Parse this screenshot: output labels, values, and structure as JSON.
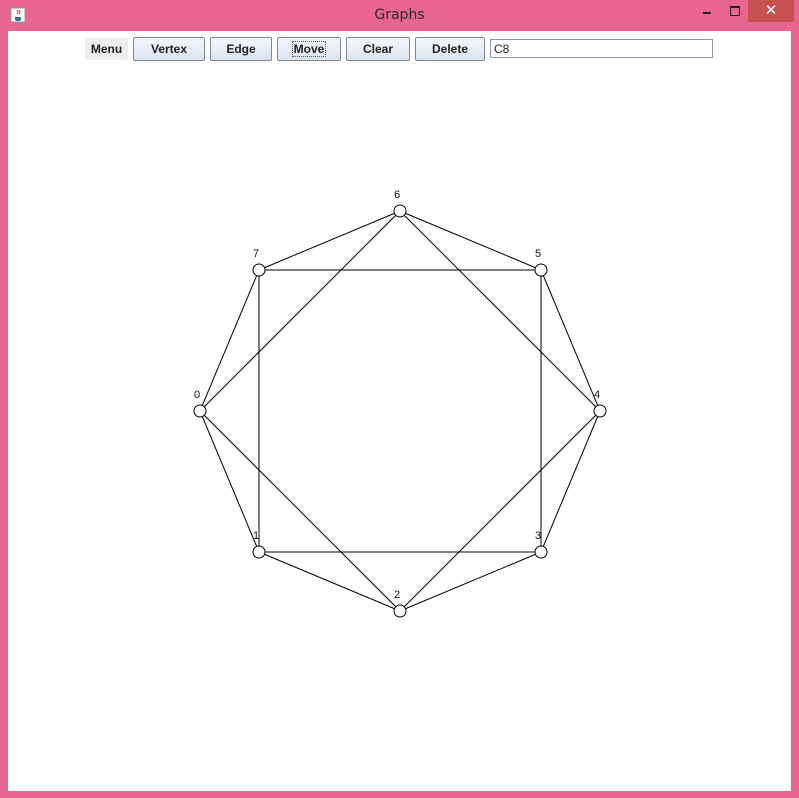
{
  "window": {
    "title": "Graphs"
  },
  "toolbar": {
    "menu_label": "Menu",
    "vertex_label": "Vertex",
    "edge_label": "Edge",
    "move_label": "Move",
    "clear_label": "Clear",
    "delete_label": "Delete",
    "graph_name_value": "C8"
  },
  "graph": {
    "vertices": [
      {
        "id": 0,
        "label": "0"
      },
      {
        "id": 1,
        "label": "1"
      },
      {
        "id": 2,
        "label": "2"
      },
      {
        "id": 3,
        "label": "3"
      },
      {
        "id": 4,
        "label": "4"
      },
      {
        "id": 5,
        "label": "5"
      },
      {
        "id": 6,
        "label": "6"
      },
      {
        "id": 7,
        "label": "7"
      }
    ],
    "edges": [
      [
        0,
        1
      ],
      [
        1,
        2
      ],
      [
        2,
        3
      ],
      [
        3,
        4
      ],
      [
        4,
        5
      ],
      [
        5,
        6
      ],
      [
        6,
        7
      ],
      [
        7,
        0
      ],
      [
        1,
        3
      ],
      [
        3,
        5
      ],
      [
        5,
        7
      ],
      [
        7,
        1
      ],
      [
        0,
        2
      ],
      [
        2,
        4
      ],
      [
        4,
        6
      ],
      [
        6,
        0
      ]
    ]
  },
  "icons": {
    "app": "java-cup-icon",
    "minimize": "minimize-icon",
    "maximize": "maximize-icon",
    "close": "close-icon"
  }
}
